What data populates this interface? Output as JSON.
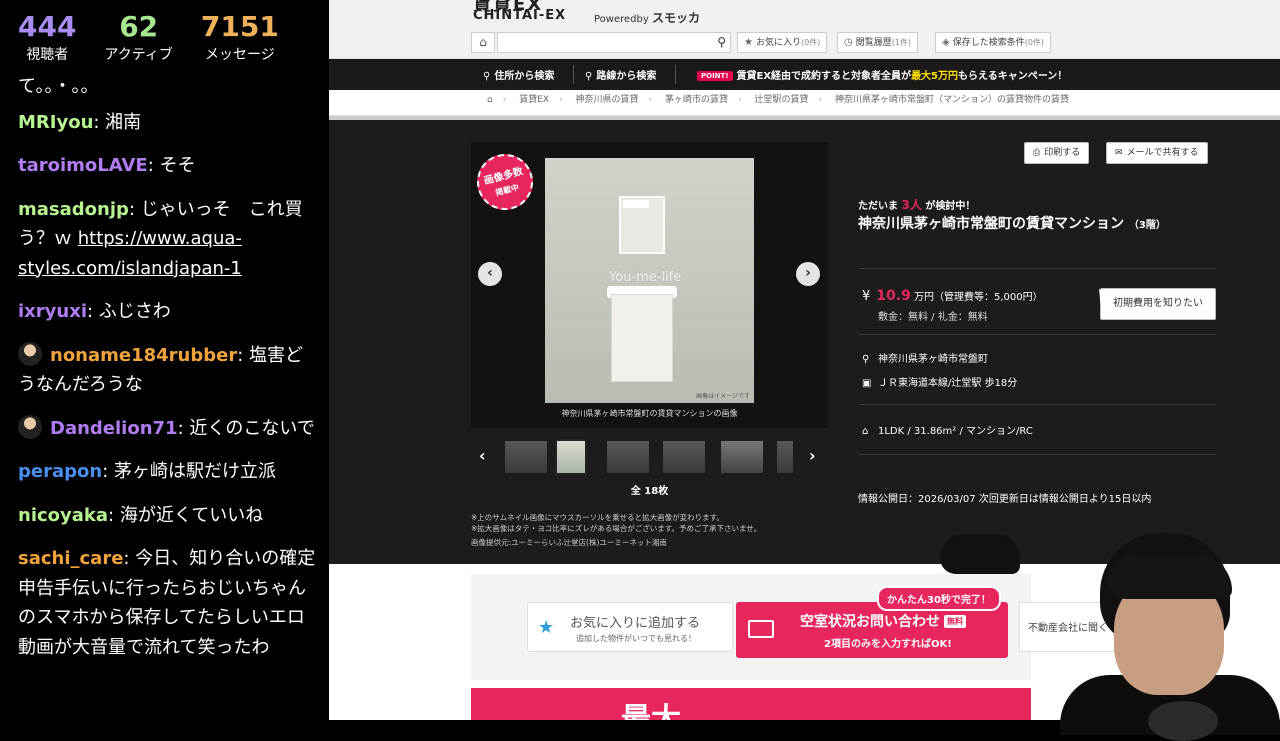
{
  "stats": [
    {
      "value": "444",
      "label": "視聴者",
      "color": "#a98cf0"
    },
    {
      "value": "62",
      "label": "アクティブ",
      "color": "#a5e88f"
    },
    {
      "value": "7151",
      "label": "メッセージ",
      "color": "#f0b15b"
    }
  ],
  "chat": [
    {
      "user": "",
      "text": "て。。・。。",
      "color": "#ffffff"
    },
    {
      "user": "MRIyou",
      "text": ": 湘南",
      "color": "#b6f28f"
    },
    {
      "user": "taroimoLAVE",
      "text": ": そそ",
      "color": "#b07cf2"
    },
    {
      "user": "masadonjp",
      "text": ": じゃいっそ　これ買う？ｗ ",
      "link": "https://www.aqua-styles.com/islandjapan-1",
      "color": "#b6f28f"
    },
    {
      "user": "ixryuxi",
      "text": ": ふじさわ",
      "color": "#b07cf2"
    },
    {
      "user": "noname184rubber",
      "text": ": 塩害どうなんだろうな",
      "color": "#f0a23c",
      "avatar": true
    },
    {
      "user": "Dandelion71",
      "text": ": 近くのこないで",
      "color": "#b07cf2",
      "avatar": true
    },
    {
      "user": "perapon",
      "text": ": 茅ヶ崎は駅だけ立派",
      "color": "#4a8ef0"
    },
    {
      "user": "nicoyaka",
      "text": ": 海が近くていいね",
      "color": "#b6f28f"
    },
    {
      "user": "sachi_care",
      "text": ": 今日、知り合いの確定申告手伝いに行ったらおじいちゃんのスマホから保存してたらしいエロ動画が大音量で流れて笑ったわ",
      "color": "#f0a23c"
    }
  ],
  "header": {
    "logo_jp": "賃貸EX",
    "logo_en": "CHINTAI-EX",
    "powered": "Poweredby",
    "powered_brand": "スモッカ",
    "search_placeholder": "",
    "favorites": "お気に入り",
    "favorites_count": "(0件)",
    "history": "閲覧履歴",
    "history_count": "(1件)",
    "saved": "保存した検索条件",
    "saved_count": "(0件)"
  },
  "nav": {
    "address": "住所から検索",
    "line": "路線から検索",
    "point": "POINT!",
    "campaign_a": "賃貸EX経由で成約すると対象者全員が",
    "campaign_hl": "最大5万円",
    "campaign_b": "もらえるキャンペーン！"
  },
  "breadcrumb": [
    "賃貸EX",
    "神奈川県の賃貸",
    "茅ヶ崎市の賃貸",
    "辻堂駅の賃貸",
    "神奈川県茅ヶ崎市常盤町（マンション）の賃貸物件の賃貸"
  ],
  "gallery": {
    "badge": "画像多数",
    "badge_sub": "掲載中",
    "watermark": "You-me-life",
    "photo_note": "画像はイメージです",
    "caption": "神奈川県茅ヶ崎市常盤町の賃貸マンションの画像",
    "total": "全 18枚",
    "notes": [
      "※上のサムネイル画像にマウスカーソルを乗せると拡大画像が変わります。",
      "※拡大画像はタテ・ヨコ比率にズレがある場合がございます。予めご了承下さいませ。",
      "画像提供元:ユーミーらいふ辻堂店(株)ユーミーネット湘南"
    ]
  },
  "detail": {
    "print": "印刷する",
    "mail_share": "メールで共有する",
    "looking_a": "ただいま",
    "looking_n": "3人",
    "looking_b": "が検討中！",
    "title": "神奈川県茅ヶ崎市常盤町の賃貸マンション",
    "title_sub": "（3階）",
    "yen": "¥",
    "price": "10.9",
    "price_unit": "万円（管理費等：5,000円）",
    "deposit": "敷金：無料 / 礼金：無料",
    "init_cost": "初期費用を知りたい",
    "address": "神奈川県茅ヶ崎市常盤町",
    "station": "ＪＲ東海道本線/辻堂駅 歩18分",
    "layout": "1LDK / 31.86m² / マンション/RC",
    "published": "情報公開日：2026/03/07 次回更新日は情報公開日より15日以内"
  },
  "actions": {
    "fav": "お気に入りに追加する",
    "fav_sub": "追加した物件がいつでも見れる！",
    "inquiry": "空室状況お問い合わせ",
    "free": "無料",
    "inquiry_sub": "2項目のみを入力すればOK!",
    "bubble": "かんたん30秒で完了！",
    "agent": "不動産会社に聞く",
    "banner": "最大"
  }
}
